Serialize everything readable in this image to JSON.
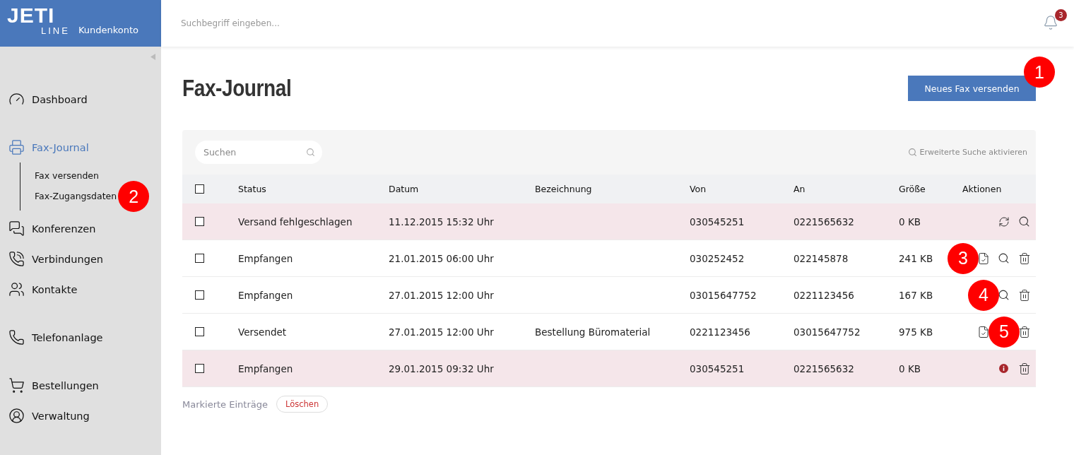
{
  "header": {
    "logo_top": "JETI",
    "logo_bottom": "LINE",
    "account_label": "Kundenkonto",
    "search": {
      "placeholder": "Suchbegriff eingeben..."
    },
    "notifications": {
      "count": "3"
    }
  },
  "sidebar": {
    "groups": [
      [
        {
          "label": "Dashboard",
          "selected": false
        }
      ],
      [
        {
          "label": "Fax-Journal",
          "selected": true,
          "children": [
            {
              "label": "Fax versenden"
            },
            {
              "label": "Fax-Zugangsdaten",
              "callout": "2"
            }
          ]
        },
        {
          "label": "Konferenzen",
          "selected": false
        },
        {
          "label": "Verbindungen",
          "selected": false
        },
        {
          "label": "Kontakte",
          "selected": false
        }
      ],
      [
        {
          "label": "Telefonanlage",
          "selected": false
        }
      ],
      [
        {
          "label": "Bestellungen",
          "selected": false
        },
        {
          "label": "Verwaltung",
          "selected": false
        }
      ]
    ]
  },
  "page": {
    "title": "Fax-Journal",
    "new_fax_button": {
      "label": "Neues Fax versenden",
      "callout": "1"
    }
  },
  "toolbar": {
    "search": {
      "placeholder": "Suchen"
    },
    "advanced_search": "Erweiterte Suche aktivieren"
  },
  "table": {
    "select_all": {
      "checked": false
    },
    "columns": [
      "Status",
      "Datum",
      "Bezeichnung",
      "Von",
      "An",
      "Größe",
      "Aktionen"
    ],
    "rows": [
      {
        "checked": false,
        "failed": true,
        "cells": [
          "Versand fehlgeschlagen",
          "11.12.2015 15:32 Uhr",
          "",
          "030545251",
          "0221565632",
          "0 KB"
        ],
        "actions": [
          {
            "kind": "refresh"
          },
          {
            "kind": "search"
          }
        ]
      },
      {
        "checked": false,
        "failed": false,
        "cells": [
          "Empfangen",
          "21.01.2015 06:00 Uhr",
          "",
          "030252452",
          "022145878",
          "241 KB"
        ],
        "actions": [
          {
            "kind": "callout",
            "label": "3"
          },
          {
            "kind": "document"
          },
          {
            "kind": "search"
          },
          {
            "kind": "delete"
          }
        ]
      },
      {
        "checked": false,
        "failed": false,
        "cells": [
          "Empfangen",
          "27.01.2015 12:00 Uhr",
          "",
          "03015647752",
          "0221123456",
          "167 KB"
        ],
        "actions": [
          {
            "kind": "callout",
            "label": "4"
          },
          {
            "kind": "search"
          },
          {
            "kind": "delete"
          }
        ]
      },
      {
        "checked": false,
        "failed": false,
        "cells": [
          "Versendet",
          "27.01.2015 12:00 Uhr",
          "Bestellung Büromaterial",
          "0221123456",
          "03015647752",
          "975 KB"
        ],
        "actions": [
          {
            "kind": "document"
          },
          {
            "kind": "callout",
            "label": "5"
          },
          {
            "kind": "delete"
          }
        ]
      },
      {
        "checked": false,
        "failed": true,
        "cells": [
          "Empfangen",
          "29.01.2015 09:32 Uhr",
          "",
          "030545251",
          "0221565632",
          "0 KB"
        ],
        "actions": [
          {
            "kind": "info"
          },
          {
            "kind": "delete"
          }
        ]
      }
    ]
  },
  "footer": {
    "label": "Markierte Einträge",
    "delete_button": "Löschen"
  }
}
